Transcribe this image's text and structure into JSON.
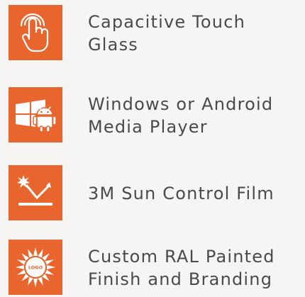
{
  "features": [
    {
      "label": "Capacitive Touch\nGlass",
      "icon": "touch-hand-icon"
    },
    {
      "label": "Windows or Android\nMedia Player",
      "icon": "windows-android-icon"
    },
    {
      "label": "3M Sun Control Film",
      "icon": "sun-reflection-icon"
    },
    {
      "label": "Custom RAL Painted\nFinish and Branding",
      "icon": "sun-logo-icon",
      "icon_text": "LOGO"
    }
  ],
  "colors": {
    "tile": "#e8652d",
    "icon": "#ffffff",
    "text": "#4a4a4a",
    "background": "#f7f5f3"
  }
}
